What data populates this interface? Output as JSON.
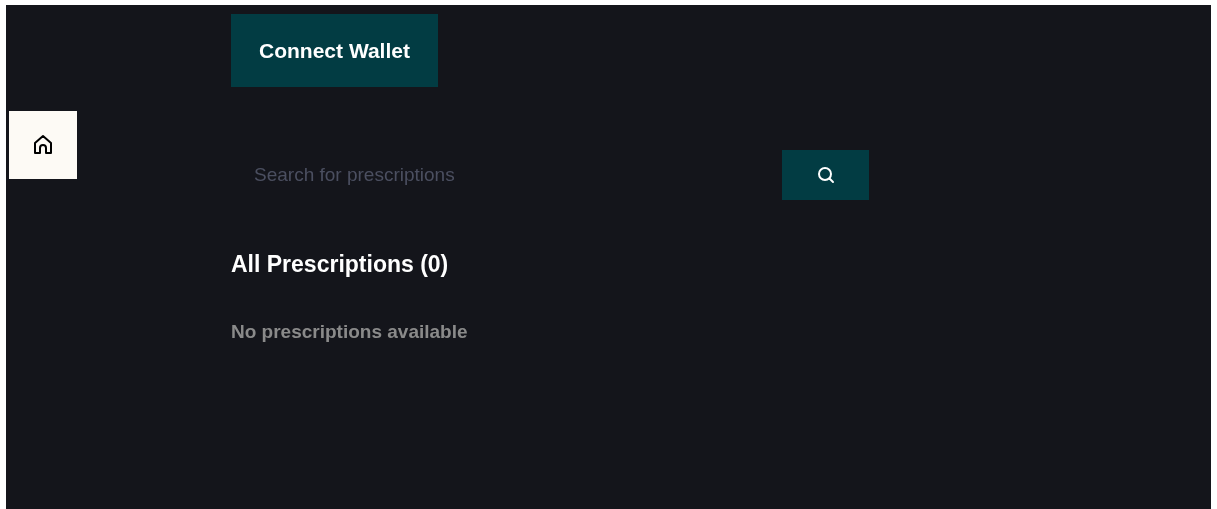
{
  "header": {
    "connect_button": "Connect Wallet"
  },
  "sidebar": {
    "items": [
      {
        "kind": "home",
        "selected": false
      }
    ]
  },
  "search": {
    "placeholder": "Search for prescriptions"
  },
  "list": {
    "title": "All Prescriptions (0)",
    "empty_message": "No prescriptions available"
  }
}
